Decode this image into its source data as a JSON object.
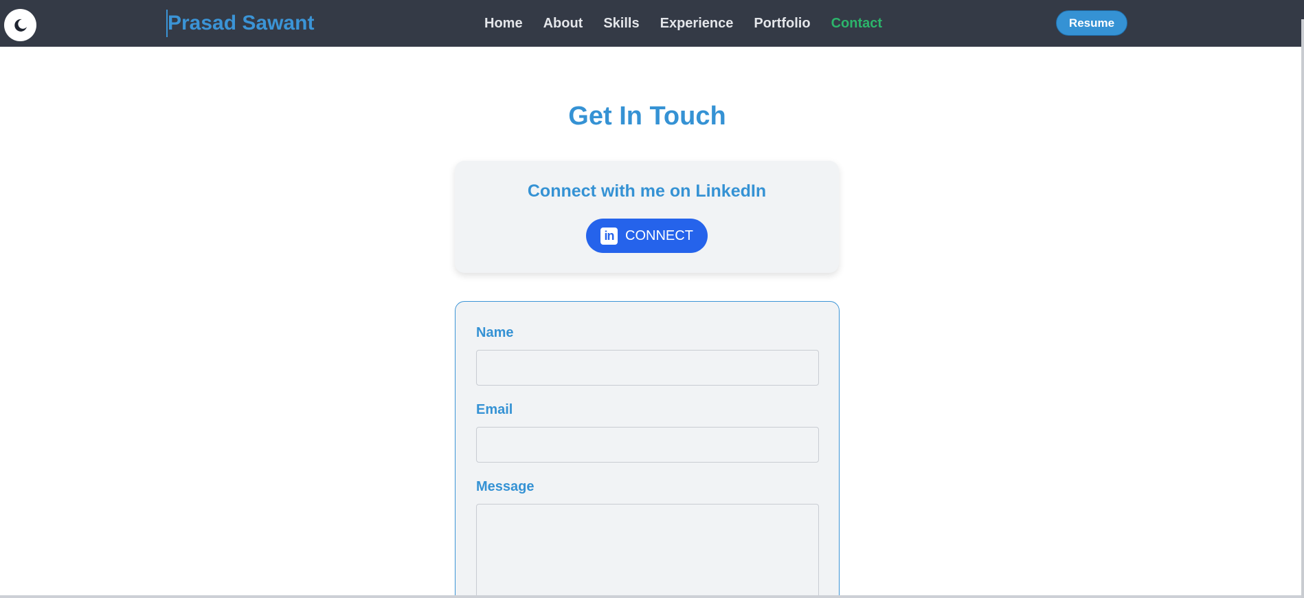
{
  "navbar": {
    "theme_icon": "moon-icon",
    "brand": "Prasad Sawant",
    "links": [
      {
        "label": "Home"
      },
      {
        "label": "About"
      },
      {
        "label": "Skills"
      },
      {
        "label": "Experience"
      },
      {
        "label": "Portfolio"
      },
      {
        "label": "Contact",
        "active": true
      }
    ],
    "resume_label": "Resume"
  },
  "contact": {
    "heading": "Get In Touch",
    "linkedin": {
      "title": "Connect with me on LinkedIn",
      "button_label": "CONNECT",
      "icon_text": "in"
    },
    "form": {
      "name_label": "Name",
      "name_value": "",
      "email_label": "Email",
      "email_value": "",
      "message_label": "Message",
      "message_value": ""
    }
  },
  "colors": {
    "navbar_bg": "#343a46",
    "accent": "#3592d4",
    "active_link": "#2cb56b",
    "linkedin_button": "#2563eb",
    "card_bg": "#f1f3f5"
  }
}
